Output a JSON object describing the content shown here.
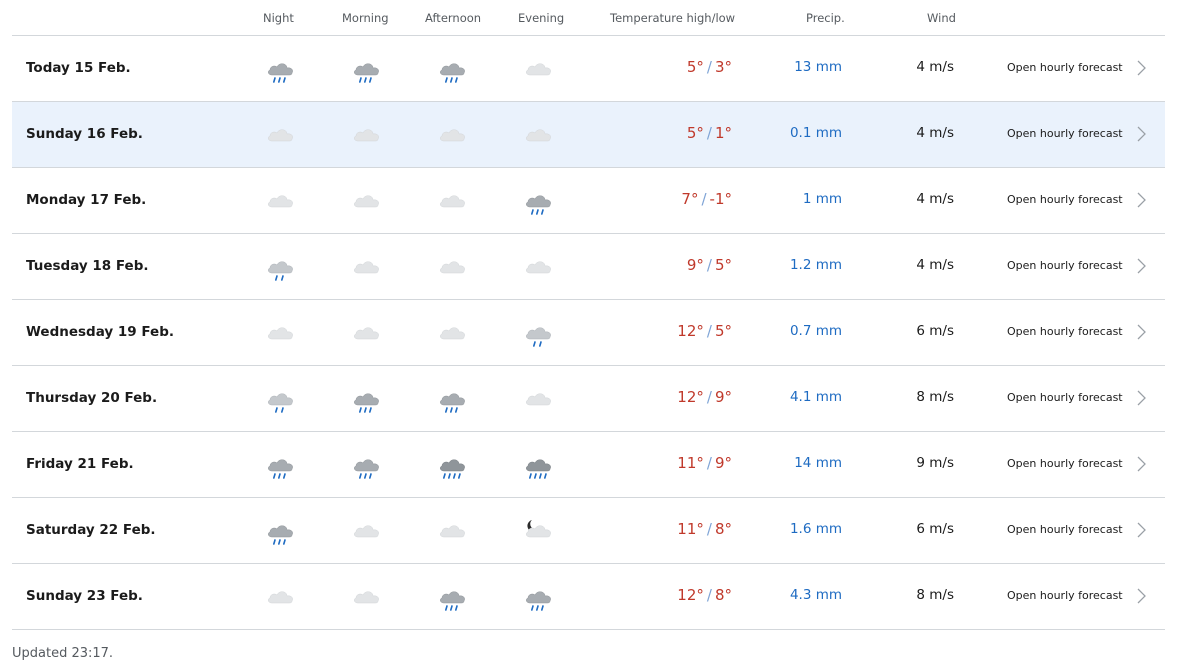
{
  "header": {
    "night": "Night",
    "morning": "Morning",
    "afternoon": "Afternoon",
    "evening": "Evening",
    "temperature": "Temperature high/low",
    "precip": "Precip.",
    "wind": "Wind"
  },
  "rows": [
    {
      "day": "Today 15 Feb.",
      "icons": [
        "rain-cloud-icon",
        "rain-cloud-icon",
        "rain-cloud-icon",
        "cloud-icon"
      ],
      "high": "5°",
      "low": "3°",
      "precip": "13 mm",
      "wind": "4 m/s",
      "link": "Open hourly forecast"
    },
    {
      "day": "Sunday 16 Feb.",
      "icons": [
        "cloud-icon",
        "cloud-icon",
        "cloud-icon",
        "cloud-icon"
      ],
      "high": "5°",
      "low": "1°",
      "precip": "0.1 mm",
      "wind": "4 m/s",
      "link": "Open hourly forecast"
    },
    {
      "day": "Monday 17 Feb.",
      "icons": [
        "cloud-icon",
        "cloud-icon",
        "cloud-icon",
        "rain-cloud-icon"
      ],
      "high": "7°",
      "low": "-1°",
      "precip": "1 mm",
      "wind": "4 m/s",
      "link": "Open hourly forecast"
    },
    {
      "day": "Tuesday 18 Feb.",
      "icons": [
        "light-rain-cloud-icon",
        "cloud-icon",
        "cloud-icon",
        "cloud-icon"
      ],
      "high": "9°",
      "low": "5°",
      "precip": "1.2 mm",
      "wind": "4 m/s",
      "link": "Open hourly forecast"
    },
    {
      "day": "Wednesday 19 Feb.",
      "icons": [
        "cloud-icon",
        "cloud-icon",
        "cloud-icon",
        "light-rain-cloud-icon"
      ],
      "high": "12°",
      "low": "5°",
      "precip": "0.7 mm",
      "wind": "6 m/s",
      "link": "Open hourly forecast"
    },
    {
      "day": "Thursday 20 Feb.",
      "icons": [
        "light-rain-cloud-icon",
        "rain-cloud-icon",
        "rain-cloud-icon",
        "cloud-icon"
      ],
      "high": "12°",
      "low": "9°",
      "precip": "4.1 mm",
      "wind": "8 m/s",
      "link": "Open hourly forecast"
    },
    {
      "day": "Friday 21 Feb.",
      "icons": [
        "rain-cloud-icon",
        "rain-cloud-icon",
        "heavy-rain-cloud-icon",
        "heavy-rain-cloud-icon"
      ],
      "high": "11°",
      "low": "9°",
      "precip": "14 mm",
      "wind": "9 m/s",
      "link": "Open hourly forecast"
    },
    {
      "day": "Saturday 22 Feb.",
      "icons": [
        "rain-cloud-icon",
        "cloud-icon",
        "cloud-icon",
        "moon-cloud-icon"
      ],
      "high": "11°",
      "low": "8°",
      "precip": "1.6 mm",
      "wind": "6 m/s",
      "link": "Open hourly forecast"
    },
    {
      "day": "Sunday 23 Feb.",
      "icons": [
        "cloud-icon",
        "cloud-icon",
        "rain-cloud-icon",
        "rain-cloud-icon"
      ],
      "high": "12°",
      "low": "8°",
      "precip": "4.3 mm",
      "wind": "8 m/s",
      "link": "Open hourly forecast"
    }
  ],
  "updated": "Updated 23:17.",
  "colors": {
    "temperature": "#c0392b",
    "precip": "#1e6bc2",
    "highlight_row": "#eaf2fc"
  }
}
